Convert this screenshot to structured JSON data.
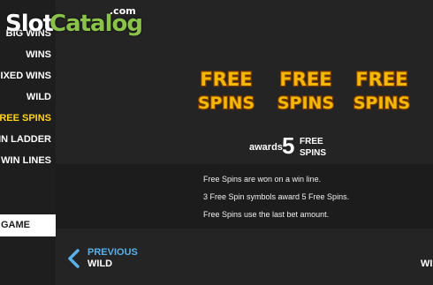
{
  "logo": {
    "slot": "Slot",
    "catalog": "Catalog",
    "com": ".com"
  },
  "sidebar": {
    "items": [
      {
        "label": "BIG WINS",
        "active": false
      },
      {
        "label": "WINS",
        "active": false
      },
      {
        "label": "MIXED WINS",
        "active": false
      },
      {
        "label": "WILD",
        "active": false
      },
      {
        "label": "FREE SPINS",
        "active": true
      },
      {
        "label": "WIN LADDER",
        "active": false
      },
      {
        "label": "WIN LINES",
        "active": false
      }
    ],
    "game_button": "GAME"
  },
  "symbols": [
    {
      "line1": "FREE",
      "line2": "SPINS"
    },
    {
      "line1": "FREE",
      "line2": "SPINS"
    },
    {
      "line1": "FREE",
      "line2": "SPINS"
    }
  ],
  "awards": {
    "label": "awards",
    "count": "5",
    "unit_line1": "FREE",
    "unit_line2": "SPINS"
  },
  "info": {
    "lines": [
      "Free Spins are won on a win line.",
      "3 Free Spin symbols award 5 Free Spins.",
      "Free Spins use the last bet amount."
    ]
  },
  "nav": {
    "previous_label": "PREVIOUS",
    "previous_name": "WILD",
    "next_name": "WI"
  },
  "colors": {
    "active": "#ffd21f",
    "accent": "#5ab0e8",
    "symbol_fill": "#f5b800",
    "symbol_outline": "#7a3a00"
  }
}
